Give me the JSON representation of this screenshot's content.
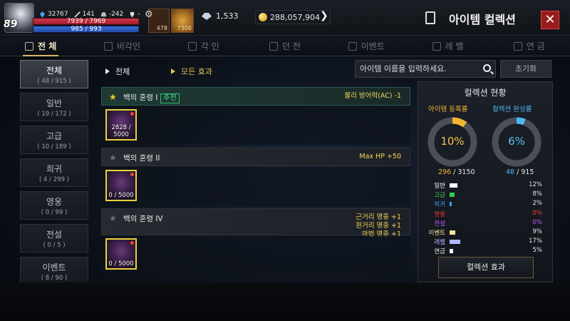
{
  "player": {
    "level": "89",
    "stat_power": "32767",
    "stat_attack": "141",
    "stat_defense": "-242",
    "stat_trophy": "-",
    "hp_text": "7939 / 7969",
    "hp_fraction": 0.996,
    "mp_text": "985 / 993",
    "mp_fraction": 0.992
  },
  "buffs": {
    "buff1_count": "478",
    "buff2_count": "7308"
  },
  "currency": {
    "crystal": "1,533",
    "gold": "288,057,904"
  },
  "header": {
    "title": "아이템 컬렉션",
    "close_label": "✕"
  },
  "tabs": [
    {
      "label": "전 체",
      "icon": "book-icon",
      "active": true
    },
    {
      "label": "비각인",
      "icon": "shield-icon",
      "active": false
    },
    {
      "label": "각 인",
      "icon": "shield-gear-icon",
      "active": false
    },
    {
      "label": "던 전",
      "icon": "arch-icon",
      "active": false
    },
    {
      "label": "이벤트",
      "icon": "gift-icon",
      "active": false
    },
    {
      "label": "레 벨",
      "icon": "level-icon",
      "active": false
    },
    {
      "label": "연 금",
      "icon": "alchemy-icon",
      "active": false
    }
  ],
  "categories": [
    {
      "name": "전체",
      "count": "( 48 / 915 )",
      "active": true
    },
    {
      "name": "일반",
      "count": "( 19 / 172 )",
      "active": false
    },
    {
      "name": "고급",
      "count": "( 10 / 189 )",
      "active": false
    },
    {
      "name": "희귀",
      "count": "( 4 / 299 )",
      "active": false
    },
    {
      "name": "영웅",
      "count": "( 0 / 99 )",
      "active": false
    },
    {
      "name": "전설",
      "count": "( 0 / 5 )",
      "active": false
    },
    {
      "name": "이벤트",
      "count": "( 8 / 90 )",
      "active": false
    }
  ],
  "filters": {
    "filter1": "전체",
    "filter2": "모든 효과"
  },
  "search": {
    "placeholder": "아이템 이름을 입력하세요.",
    "reset_label": "초기화"
  },
  "sets": [
    {
      "name": "백의 혼령 I",
      "recommended": true,
      "badge": "추천",
      "effects": [
        "물리 방어력(AC) -1"
      ],
      "item_count": "2828 / 5000"
    },
    {
      "name": "백의 혼령 II",
      "recommended": false,
      "badge": "",
      "effects": [
        "Max HP +50"
      ],
      "item_count": "0 / 5000"
    },
    {
      "name": "백의 혼령 IV",
      "recommended": false,
      "badge": "",
      "effects": [
        "근거리 명중 +1",
        "원거리 명중 +1",
        "마법 명중 +1"
      ],
      "item_count": "0 / 5000"
    }
  ],
  "panel": {
    "title": "컬렉션 현황",
    "registration_label": "아이템 등록률",
    "completion_label": "컬렉션 완성률",
    "registration_pct": "10%",
    "registration_value": 10,
    "completion_pct": "6%",
    "completion_value": 6,
    "registered": "296",
    "registered_total": " / 3150",
    "completed": "48",
    "completed_total": " / 915",
    "breakdown": [
      {
        "name": "일반",
        "pct": "12%",
        "value": 12,
        "color": "#ffffff"
      },
      {
        "name": "고급",
        "pct": "8%",
        "value": 8,
        "color": "#2fd04a"
      },
      {
        "name": "희귀",
        "pct": "2%",
        "value": 2,
        "color": "#3aa0ff"
      },
      {
        "name": "영웅",
        "pct": "0%",
        "value": 0,
        "color": "#ff3a3a"
      },
      {
        "name": "전설",
        "pct": "0%",
        "value": 0,
        "color": "#c35bff"
      },
      {
        "name": "이벤트",
        "pct": "9%",
        "value": 9,
        "color": "#f2e6a0"
      },
      {
        "name": "레벨",
        "pct": "17%",
        "value": 17,
        "color": "#b4b8ff"
      },
      {
        "name": "연금",
        "pct": "5%",
        "value": 5,
        "color": "#f0f0f0"
      }
    ],
    "effect_button": "컬렉션 효과",
    "registration_color": "#f2b530",
    "completion_color": "#4fb8f0"
  }
}
